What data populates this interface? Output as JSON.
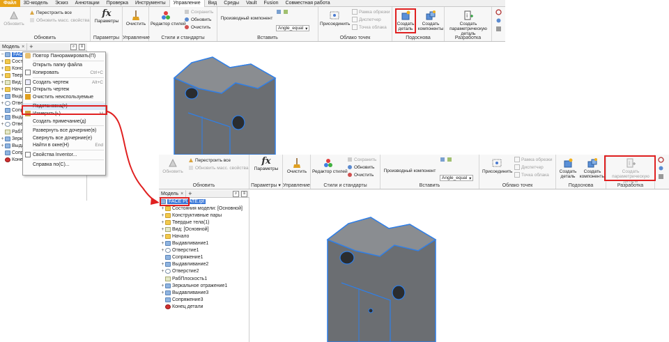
{
  "ribbon_tabs": [
    "Файл",
    "3D-модель",
    "Эскиз",
    "Аннотации",
    "Проверка",
    "Инструменты",
    "Управление",
    "Вид",
    "Среды",
    "Vault",
    "Fusion",
    "Совместная работа"
  ],
  "ribbon": {
    "update": {
      "label": "Обновить",
      "btn": "Обновить",
      "rebuild": "Перестроить все",
      "mass": "Обновить масс. свойства"
    },
    "params": {
      "label": "Параметры",
      "btn": "Параметры"
    },
    "manage": {
      "label": "Управление",
      "btn": "Очистить"
    },
    "styles": {
      "label": "Стили и стандарты",
      "editor": "Редактор стилей",
      "save": "Сохранить",
      "update": "Обновить",
      "clear": "Очистить"
    },
    "insert": {
      "label": "Вставить",
      "derived": "Производный компонент",
      "dropdown": "Angle_equal"
    },
    "cloud": {
      "label": "Облако точек",
      "attach": "Присоединить",
      "crop": "Рамка обрезки",
      "dispatcher": "Диспетчер",
      "point": "Точка облака"
    },
    "layout": {
      "label": "Подоснова",
      "create_part": "Создать деталь",
      "create_components": "Создать компоненты"
    },
    "dev": {
      "label": "Разработка",
      "create_param": "Создать параметрическую деталь"
    }
  },
  "browser": {
    "tab": "Модель",
    "close": "×",
    "add": "+",
    "search_icon": "⌕",
    "menu_icon": "≡",
    "root": "FACE PLATE.ipt",
    "root_short": "FACE PL",
    "items": [
      "Состояния модели: [Основной]",
      "Конструктивные пары",
      "Твердые тела(1)",
      "Вид: [Основной]",
      "Начало",
      "Выдавливание1",
      "Отверстие1",
      "Сопряжение1",
      "Выдавливание2",
      "Отверстие2",
      "РабПлоскость1",
      "Зеркальное отражение1",
      "Выдавливание3",
      "Сопряжение3",
      "Конец детали"
    ],
    "items_short": [
      "Сост",
      "Конс",
      "Твер",
      "Вид:",
      "Нача",
      "Выда",
      "Отве",
      "Сопр",
      "Выда",
      "Отве",
      "РабП",
      "Зерк",
      "Выда",
      "Сопр",
      "Коне"
    ]
  },
  "context_menu": [
    {
      "label": "Повтор Панорамировать(П)",
      "shortcut": ""
    },
    {
      "label": "Открыть папку файла",
      "shortcut": ""
    },
    {
      "label": "Копировать",
      "shortcut": "Ctrl+C"
    },
    {
      "label": "Создать чертеж",
      "shortcut": "Alt+C"
    },
    {
      "label": "Открыть чертеж",
      "shortcut": ""
    },
    {
      "label": "Очистить неиспользуемые",
      "shortcut": ""
    },
    {
      "label": "Подстановка(т)",
      "shortcut": ""
    },
    {
      "label": "Измерить(ь)",
      "shortcut": "M"
    },
    {
      "label": "Создать примечание(д)",
      "shortcut": ""
    },
    {
      "label": "Развернуть все дочерние(в)",
      "shortcut": ""
    },
    {
      "label": "Свернуть все дочерние(е)",
      "shortcut": ""
    },
    {
      "label": "Найти в окне(Н)",
      "shortcut": "End"
    },
    {
      "label": "Свойства Inventor...",
      "shortcut": ""
    },
    {
      "label": "Справка по(С)...",
      "shortcut": ""
    }
  ],
  "colors": {
    "accent_red": "#e02020",
    "selection": "#3a78d8",
    "model_edge": "#2f7fe8",
    "model_face": "#6b6e72"
  }
}
